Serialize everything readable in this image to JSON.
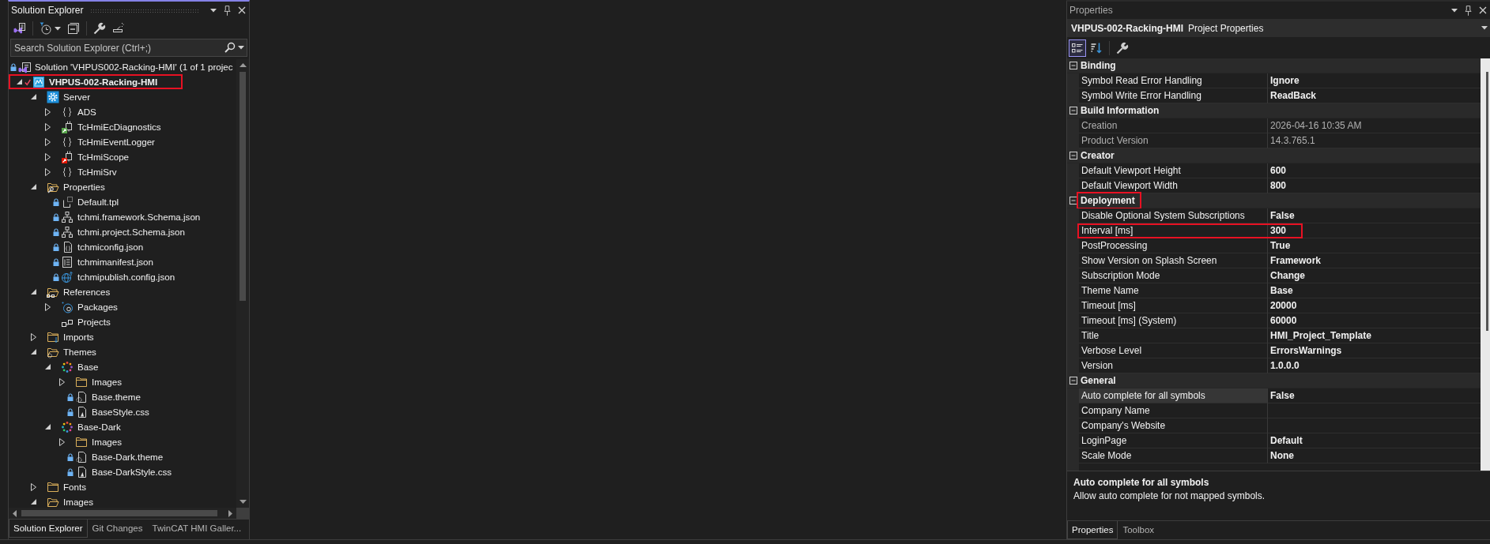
{
  "solution_explorer": {
    "title": "Solution Explorer",
    "search": {
      "placeholder": "Search Solution Explorer (Ctrl+;)"
    },
    "tree": [
      {
        "label": "Solution 'VHPUS002-Racking-HMI' (1 of 1 projec",
        "kind": "solution",
        "locked": true,
        "children": [
          {
            "label": "VHPUS-002-Racking-HMI",
            "kind": "project",
            "checked_out": true,
            "expanded": true,
            "highlighted": true,
            "children": [
              {
                "label": "Server",
                "kind": "server",
                "expanded": true,
                "children": [
                  {
                    "label": "ADS",
                    "kind": "module",
                    "expanded": false
                  },
                  {
                    "label": "TcHmiEcDiagnostics",
                    "kind": "extension",
                    "color": "#57a64a",
                    "expanded": false
                  },
                  {
                    "label": "TcHmiEventLogger",
                    "kind": "module",
                    "expanded": false
                  },
                  {
                    "label": "TcHmiScope",
                    "kind": "extension",
                    "color": "#e51400",
                    "expanded": false
                  },
                  {
                    "label": "TcHmiSrv",
                    "kind": "module",
                    "expanded": false
                  }
                ]
              },
              {
                "label": "Properties",
                "kind": "properties",
                "expanded": true,
                "children": [
                  {
                    "label": "Default.tpl",
                    "kind": "template",
                    "locked": true
                  },
                  {
                    "label": "tchmi.framework.Schema.json",
                    "kind": "schema",
                    "locked": true
                  },
                  {
                    "label": "tchmi.project.Schema.json",
                    "kind": "schema",
                    "locked": true
                  },
                  {
                    "label": "tchmiconfig.json",
                    "kind": "config",
                    "locked": true
                  },
                  {
                    "label": "tchmimanifest.json",
                    "kind": "manifest",
                    "locked": true
                  },
                  {
                    "label": "tchmipublish.config.json",
                    "kind": "publish",
                    "locked": true
                  }
                ]
              },
              {
                "label": "References",
                "kind": "references",
                "expanded": true,
                "children": [
                  {
                    "label": "Packages",
                    "kind": "packages",
                    "expanded": false
                  },
                  {
                    "label": "Projects",
                    "kind": "projects"
                  }
                ]
              },
              {
                "label": "Imports",
                "kind": "imports",
                "expanded": false
              },
              {
                "label": "Themes",
                "kind": "themes",
                "expanded": true,
                "children": [
                  {
                    "label": "Base",
                    "kind": "theme",
                    "expanded": true,
                    "children": [
                      {
                        "label": "Images",
                        "kind": "folder",
                        "expanded": false
                      },
                      {
                        "label": "Base.theme",
                        "kind": "themefile",
                        "locked": true
                      },
                      {
                        "label": "BaseStyle.css",
                        "kind": "stylesheet",
                        "locked": true
                      }
                    ]
                  },
                  {
                    "label": "Base-Dark",
                    "kind": "theme",
                    "expanded": true,
                    "children": [
                      {
                        "label": "Images",
                        "kind": "folder",
                        "expanded": false
                      },
                      {
                        "label": "Base-Dark.theme",
                        "kind": "themefile",
                        "locked": true
                      },
                      {
                        "label": "Base-DarkStyle.css",
                        "kind": "stylesheet",
                        "locked": true
                      }
                    ]
                  }
                ]
              },
              {
                "label": "Fonts",
                "kind": "folder",
                "expanded": false
              },
              {
                "label": "Images",
                "kind": "folder",
                "expanded": true
              }
            ]
          }
        ]
      }
    ],
    "tabs": [
      {
        "label": "Solution Explorer",
        "selected": true
      },
      {
        "label": "Git Changes",
        "selected": false
      },
      {
        "label": "TwinCAT HMI Galler...",
        "selected": false
      }
    ]
  },
  "properties": {
    "title": "Properties",
    "object": {
      "name": "VHPUS-002-Racking-HMI",
      "type": "Project Properties"
    },
    "view_buttons": [
      {
        "kind": "categorized",
        "selected": true
      },
      {
        "kind": "alphabetical",
        "selected": false
      }
    ],
    "categories": [
      {
        "name": "Binding",
        "expanded": true,
        "properties": [
          {
            "name": "Symbol Read Error Handling",
            "value": "Ignore",
            "readonly": false,
            "selected": false
          },
          {
            "name": "Symbol Write Error Handling",
            "value": "ReadBack",
            "readonly": false,
            "selected": false
          }
        ]
      },
      {
        "name": "Build Information",
        "expanded": true,
        "properties": [
          {
            "name": "Creation",
            "value": "2026-04-16 10:35 AM",
            "readonly": true,
            "selected": false
          },
          {
            "name": "Product Version",
            "value": "14.3.765.1",
            "readonly": true,
            "selected": false
          }
        ]
      },
      {
        "name": "Creator",
        "expanded": true,
        "properties": [
          {
            "name": "Default Viewport Height",
            "value": "600",
            "readonly": false,
            "selected": false
          },
          {
            "name": "Default Viewport Width",
            "value": "800",
            "readonly": false,
            "selected": false
          }
        ]
      },
      {
        "name": "Deployment",
        "expanded": true,
        "highlighted": true,
        "properties": [
          {
            "name": "Disable Optional System Subscriptions",
            "value": "False",
            "readonly": false,
            "selected": false
          },
          {
            "name": "Interval [ms]",
            "value": "300",
            "readonly": false,
            "selected": false,
            "highlighted": true
          },
          {
            "name": "PostProcessing",
            "value": "True",
            "readonly": false,
            "selected": false
          },
          {
            "name": "Show Version on Splash Screen",
            "value": "Framework",
            "readonly": false,
            "selected": false
          },
          {
            "name": "Subscription Mode",
            "value": "Change",
            "readonly": false,
            "selected": false
          },
          {
            "name": "Theme Name",
            "value": "Base",
            "readonly": false,
            "selected": false
          },
          {
            "name": "Timeout [ms]",
            "value": "20000",
            "readonly": false,
            "selected": false
          },
          {
            "name": "Timeout [ms] (System)",
            "value": "60000",
            "readonly": false,
            "selected": false
          },
          {
            "name": "Title",
            "value": "HMI_Project_Template",
            "readonly": false,
            "selected": false
          },
          {
            "name": "Verbose Level",
            "value": "ErrorsWarnings",
            "readonly": false,
            "selected": false
          },
          {
            "name": "Version",
            "value": "1.0.0.0",
            "readonly": false,
            "selected": false
          }
        ]
      },
      {
        "name": "General",
        "expanded": true,
        "properties": [
          {
            "name": "Auto complete for all symbols",
            "value": "False",
            "readonly": false,
            "selected": true
          },
          {
            "name": "Company Name",
            "readonly": false,
            "selected": false
          },
          {
            "name": "Company's Website",
            "readonly": false,
            "selected": false
          },
          {
            "name": "LoginPage",
            "value": "Default",
            "readonly": false,
            "selected": false
          },
          {
            "name": "Scale Mode",
            "value": "None",
            "readonly": false,
            "selected": false
          }
        ]
      }
    ],
    "description": {
      "title": "Auto complete for all symbols",
      "text": "Allow auto complete for not mapped symbols."
    },
    "tabs": [
      {
        "label": "Properties",
        "selected": true
      },
      {
        "label": "Toolbox",
        "selected": false
      }
    ]
  }
}
